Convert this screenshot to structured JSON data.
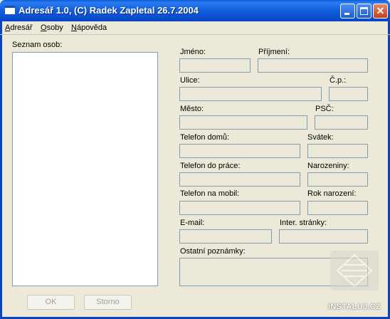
{
  "window": {
    "title": "Adresář 1.0, (C) Radek Zapletal 26.7.2004",
    "controls": {
      "minimize": "minimize",
      "maximize": "maximize",
      "close": "✕"
    }
  },
  "menu": [
    {
      "label": "Adresář",
      "underline": "A",
      "rest": "dresář"
    },
    {
      "label": "Osoby",
      "underline": "O",
      "rest": "soby"
    },
    {
      "label": "Nápověda",
      "underline": "N",
      "rest": "ápověda"
    }
  ],
  "list": {
    "label": "Seznam osob:",
    "items": []
  },
  "form": {
    "jmeno": {
      "label": "Jméno:",
      "value": ""
    },
    "prijmeni": {
      "label": "Příjmení:",
      "value": ""
    },
    "ulice": {
      "label": "Ulice:",
      "value": ""
    },
    "cp": {
      "label": "Č.p.:",
      "value": ""
    },
    "mesto": {
      "label": "Město:",
      "value": ""
    },
    "psc": {
      "label": "PSČ:",
      "value": ""
    },
    "telefon_domu": {
      "label": "Telefon domů:",
      "value": ""
    },
    "svatek": {
      "label": "Svátek:",
      "value": ""
    },
    "telefon_prace": {
      "label": "Telefon do práce:",
      "value": ""
    },
    "narozeniny": {
      "label": "Narozeniny:",
      "value": ""
    },
    "telefon_mobil": {
      "label": "Telefon na mobil:",
      "value": ""
    },
    "rok_narozeni": {
      "label": "Rok narození:",
      "value": ""
    },
    "email": {
      "label": "E-mail:",
      "value": ""
    },
    "stranky": {
      "label": "Inter. stránky:",
      "value": ""
    },
    "poznamky": {
      "label": "Ostatní poznámky:",
      "value": ""
    }
  },
  "buttons": {
    "ok": "OK",
    "storno": "Storno"
  },
  "watermark": {
    "text": "INSTALUJ.CZ"
  }
}
